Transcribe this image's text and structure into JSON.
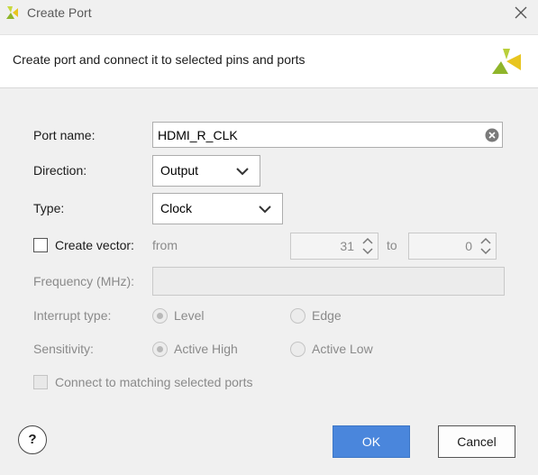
{
  "window": {
    "title": "Create Port",
    "logo_icon": "vivado-logo-icon",
    "close_icon": "close-icon"
  },
  "header": {
    "description": "Create port and connect it to selected pins and ports"
  },
  "form": {
    "port_name": {
      "label": "Port name:",
      "value": "HDMI_R_CLK"
    },
    "direction": {
      "label": "Direction:",
      "value": "Output"
    },
    "type": {
      "label": "Type:",
      "value": "Clock"
    },
    "create_vector": {
      "label": "Create vector:",
      "checked": false,
      "from_label": "from",
      "from_value": "31",
      "to_label": "to",
      "to_value": "0"
    },
    "frequency": {
      "label": "Frequency (MHz):",
      "value": ""
    },
    "interrupt_type": {
      "label": "Interrupt type:",
      "options": [
        "Level",
        "Edge"
      ],
      "selected": "Level"
    },
    "sensitivity": {
      "label": "Sensitivity:",
      "options": [
        "Active High",
        "Active Low"
      ],
      "selected": "Active High"
    },
    "connect_matching": {
      "label": "Connect to matching selected ports",
      "checked": false
    }
  },
  "buttons": {
    "help": "?",
    "ok": "OK",
    "cancel": "Cancel"
  },
  "colors": {
    "accent": "#4a86dc",
    "logo_green": "#a6c63a",
    "logo_yellow": "#e6c81e"
  }
}
